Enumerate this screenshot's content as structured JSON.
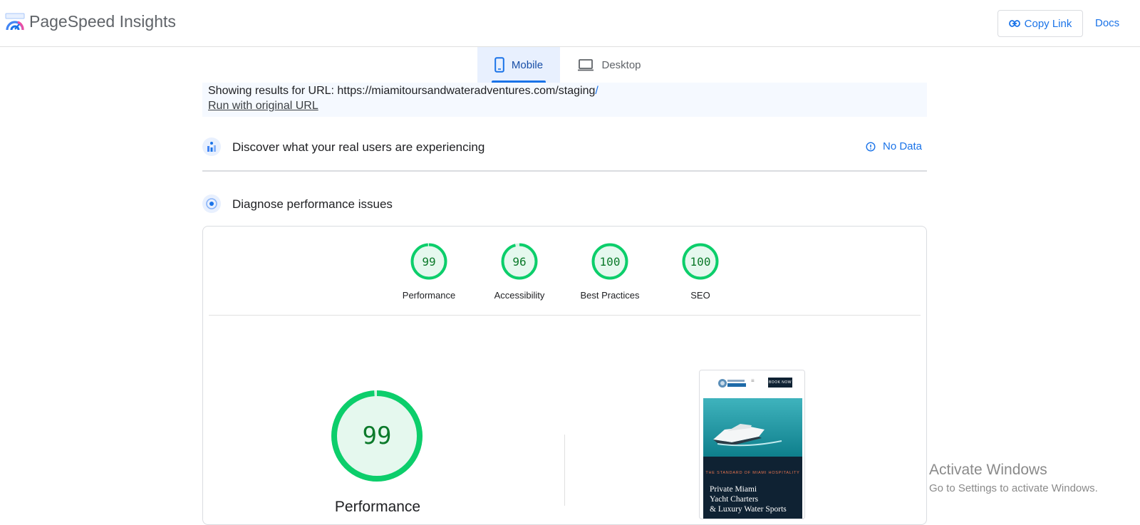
{
  "header": {
    "app_title": "PageSpeed Insights",
    "copy_link_label": "Copy Link",
    "docs_label": "Docs"
  },
  "tabs": [
    {
      "label": "Mobile",
      "selected": true
    },
    {
      "label": "Desktop",
      "selected": false
    }
  ],
  "url_notice": {
    "prefix": "Showing results for URL: ",
    "url": "https://miamitoursandwateradventures.com/staging",
    "trailing": "/",
    "run_original": "Run with original URL"
  },
  "field_section": {
    "title": "Discover what your real users are experiencing",
    "status": "No Data"
  },
  "lab_section": {
    "title": "Diagnose performance issues"
  },
  "scores": [
    {
      "label": "Performance",
      "value": "99",
      "fraction": 0.99
    },
    {
      "label": "Accessibility",
      "value": "96",
      "fraction": 0.96
    },
    {
      "label": "Best Practices",
      "value": "100",
      "fraction": 1.0
    },
    {
      "label": "SEO",
      "value": "100",
      "fraction": 1.0
    }
  ],
  "main_gauge": {
    "label": "Performance",
    "value": "99",
    "fraction": 0.99
  },
  "screenshot": {
    "book_button": "BOOK NOW",
    "menu_glyph": "≡",
    "tagline": "THE STANDARD OF MIAMI HOSPITALITY",
    "headline_1": "Private Miami",
    "headline_2": "Yacht Charters",
    "headline_3": "& Luxury Water Sports"
  },
  "watermark": {
    "title": "Activate Windows",
    "subtitle": "Go to Settings to activate Windows."
  },
  "colors": {
    "accent": "#1a73e8",
    "pass_green": "#0cce6b",
    "pass_text": "#0c7a2b",
    "pass_fill": "#e5f8ee"
  }
}
